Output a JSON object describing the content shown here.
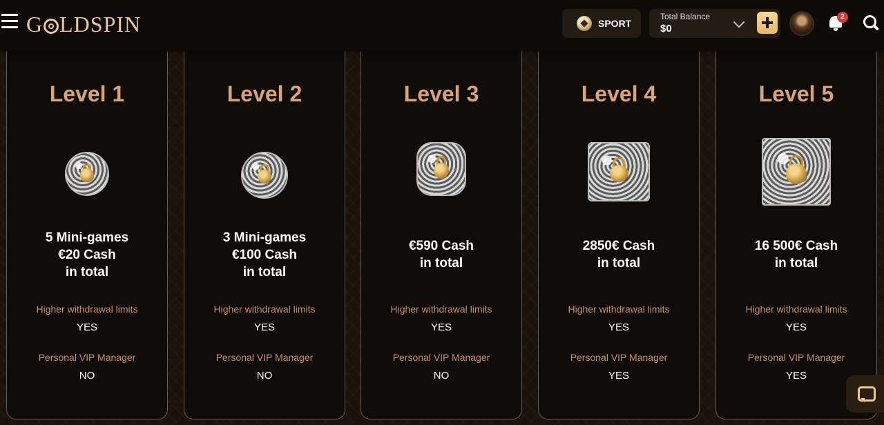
{
  "header": {
    "logo_text": "GOLDSPIN",
    "sport_label": "SPORT",
    "balance_label": "Total Balance",
    "balance_value": "$0",
    "notification_count": "2"
  },
  "levels": [
    {
      "title": "Level 1",
      "reward_lines": [
        "5 Mini-games",
        "€20 Cash",
        "in total"
      ],
      "withdrawal_label": "Higher withdrawal limits",
      "withdrawal_value": "YES",
      "vip_label": "Personal VIP Manager",
      "vip_value": "NO",
      "gem_icon": "sphere-lock-icon"
    },
    {
      "title": "Level 2",
      "reward_lines": [
        "3 Mini-games",
        "€100 Cash",
        "in total"
      ],
      "withdrawal_label": "Higher withdrawal limits",
      "withdrawal_value": "YES",
      "vip_label": "Personal VIP Manager",
      "vip_value": "NO",
      "gem_icon": "sphere-lock-icon"
    },
    {
      "title": "Level 3",
      "reward_lines": [
        "€590 Cash",
        "in total"
      ],
      "withdrawal_label": "Higher withdrawal limits",
      "withdrawal_value": "YES",
      "vip_label": "Personal VIP Manager",
      "vip_value": "NO",
      "gem_icon": "rounded-cube-lock-icon"
    },
    {
      "title": "Level 4",
      "reward_lines": [
        "2850€ Cash",
        "in total"
      ],
      "withdrawal_label": "Higher withdrawal limits",
      "withdrawal_value": "YES",
      "vip_label": "Personal VIP Manager",
      "vip_value": "YES",
      "gem_icon": "cube-lock-icon"
    },
    {
      "title": "Level 5",
      "reward_lines": [
        "16 500€ Cash",
        "in total"
      ],
      "withdrawal_label": "Higher withdrawal limits",
      "withdrawal_value": "YES",
      "vip_label": "Personal VIP Manager",
      "vip_value": "YES",
      "gem_icon": "large-cube-lock-icon"
    }
  ]
}
